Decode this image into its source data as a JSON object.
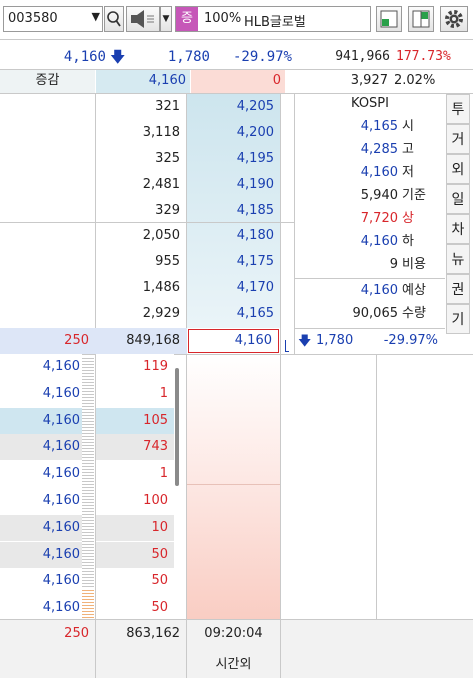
{
  "toolbar": {
    "code": "003580",
    "zoom": "100%",
    "stock_name": "HLB글로벌",
    "badge": "증"
  },
  "summary": {
    "price": "4,160",
    "change": "1,780",
    "rate": "-29.97%",
    "volume": "941,966",
    "vol_rate": "177.73%"
  },
  "diff_row": {
    "label": "증감",
    "ask_diff": "4,160",
    "bid_diff": "0",
    "val": "3,927",
    "pct": "2.02%"
  },
  "asks": [
    {
      "qty": "321",
      "price": "4,205"
    },
    {
      "qty": "3,118",
      "price": "4,200"
    },
    {
      "qty": "325",
      "price": "4,195"
    },
    {
      "qty": "2,481",
      "price": "4,190"
    },
    {
      "qty": "329",
      "price": "4,185"
    },
    {
      "qty": "2,050",
      "price": "4,180"
    },
    {
      "qty": "955",
      "price": "4,175"
    },
    {
      "qty": "1,486",
      "price": "4,170"
    },
    {
      "qty": "2,929",
      "price": "4,165"
    }
  ],
  "current": {
    "left": "250",
    "qty": "849,168",
    "price": "4,160"
  },
  "info": {
    "market": "KOSPI",
    "rows": [
      {
        "value": "4,165",
        "label": "시"
      },
      {
        "value": "4,285",
        "label": "고"
      },
      {
        "value": "4,160",
        "label": "저"
      },
      {
        "value": "5,940",
        "label": "기준"
      },
      {
        "value": "7,720",
        "label": "상"
      },
      {
        "value": "4,160",
        "label": "하"
      },
      {
        "value": "9",
        "label": "비용"
      },
      {
        "value": "4,160",
        "label": "예상"
      },
      {
        "value": "90,065",
        "label": "수량"
      }
    ],
    "bottom_change": "1,780",
    "bottom_rate": "-29.97%"
  },
  "tabs": [
    "투",
    "거",
    "외",
    "일",
    "차",
    "뉴",
    "권",
    "기"
  ],
  "trades": [
    {
      "price": "4,160",
      "qty": "119"
    },
    {
      "price": "4,160",
      "qty": "1"
    },
    {
      "price": "4,160",
      "qty": "105"
    },
    {
      "price": "4,160",
      "qty": "743"
    },
    {
      "price": "4,160",
      "qty": "1"
    },
    {
      "price": "4,160",
      "qty": "100"
    },
    {
      "price": "4,160",
      "qty": "10"
    },
    {
      "price": "4,160",
      "qty": "50"
    },
    {
      "price": "4,160",
      "qty": "50"
    },
    {
      "price": "4,160",
      "qty": "50"
    }
  ],
  "footer": {
    "left": "250",
    "total": "863,162",
    "time": "09:20:04",
    "session": "시간외"
  },
  "colors": {
    "ask_price_bg": "#d6eaf1",
    "bid_price_bg": "#fbdcd6",
    "up": "#d8262b",
    "down": "#1a3fb0"
  }
}
